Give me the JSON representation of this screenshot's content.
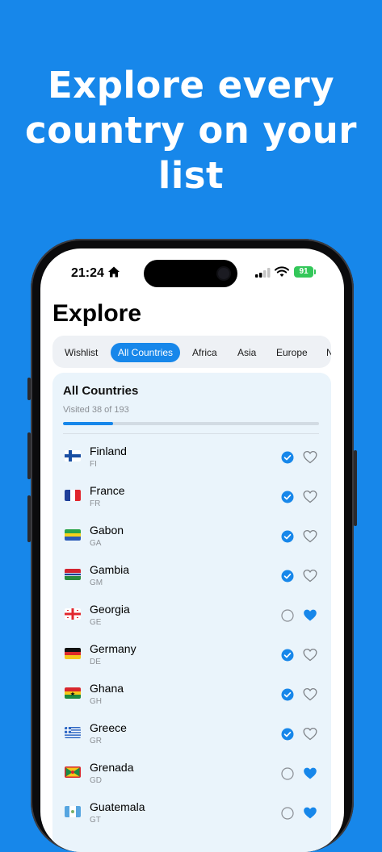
{
  "headline": [
    "Explore every",
    "country on your",
    "list"
  ],
  "status_bar": {
    "time": "21:24",
    "battery": "91"
  },
  "page": {
    "title": "Explore"
  },
  "filters": [
    {
      "label": "Wishlist",
      "active": false
    },
    {
      "label": "All Countries",
      "active": true
    },
    {
      "label": "Africa",
      "active": false
    },
    {
      "label": "Asia",
      "active": false
    },
    {
      "label": "Europe",
      "active": false
    },
    {
      "label": "N",
      "active": false
    }
  ],
  "summary": {
    "title": "All Countries",
    "subtitle": "Visited 38 of 193",
    "progress": 0.197
  },
  "countries": [
    {
      "name": "Finland",
      "code": "FI",
      "visited": true,
      "wishlist": false
    },
    {
      "name": "France",
      "code": "FR",
      "visited": true,
      "wishlist": false
    },
    {
      "name": "Gabon",
      "code": "GA",
      "visited": true,
      "wishlist": false
    },
    {
      "name": "Gambia",
      "code": "GM",
      "visited": true,
      "wishlist": false
    },
    {
      "name": "Georgia",
      "code": "GE",
      "visited": false,
      "wishlist": true
    },
    {
      "name": "Germany",
      "code": "DE",
      "visited": true,
      "wishlist": false
    },
    {
      "name": "Ghana",
      "code": "GH",
      "visited": true,
      "wishlist": false
    },
    {
      "name": "Greece",
      "code": "GR",
      "visited": true,
      "wishlist": false
    },
    {
      "name": "Grenada",
      "code": "GD",
      "visited": false,
      "wishlist": true
    },
    {
      "name": "Guatemala",
      "code": "GT",
      "visited": false,
      "wishlist": true
    }
  ],
  "colors": {
    "accent": "#1787ea",
    "background": "#1787ea",
    "card": "#eaf4fb",
    "battery": "#33c759"
  }
}
